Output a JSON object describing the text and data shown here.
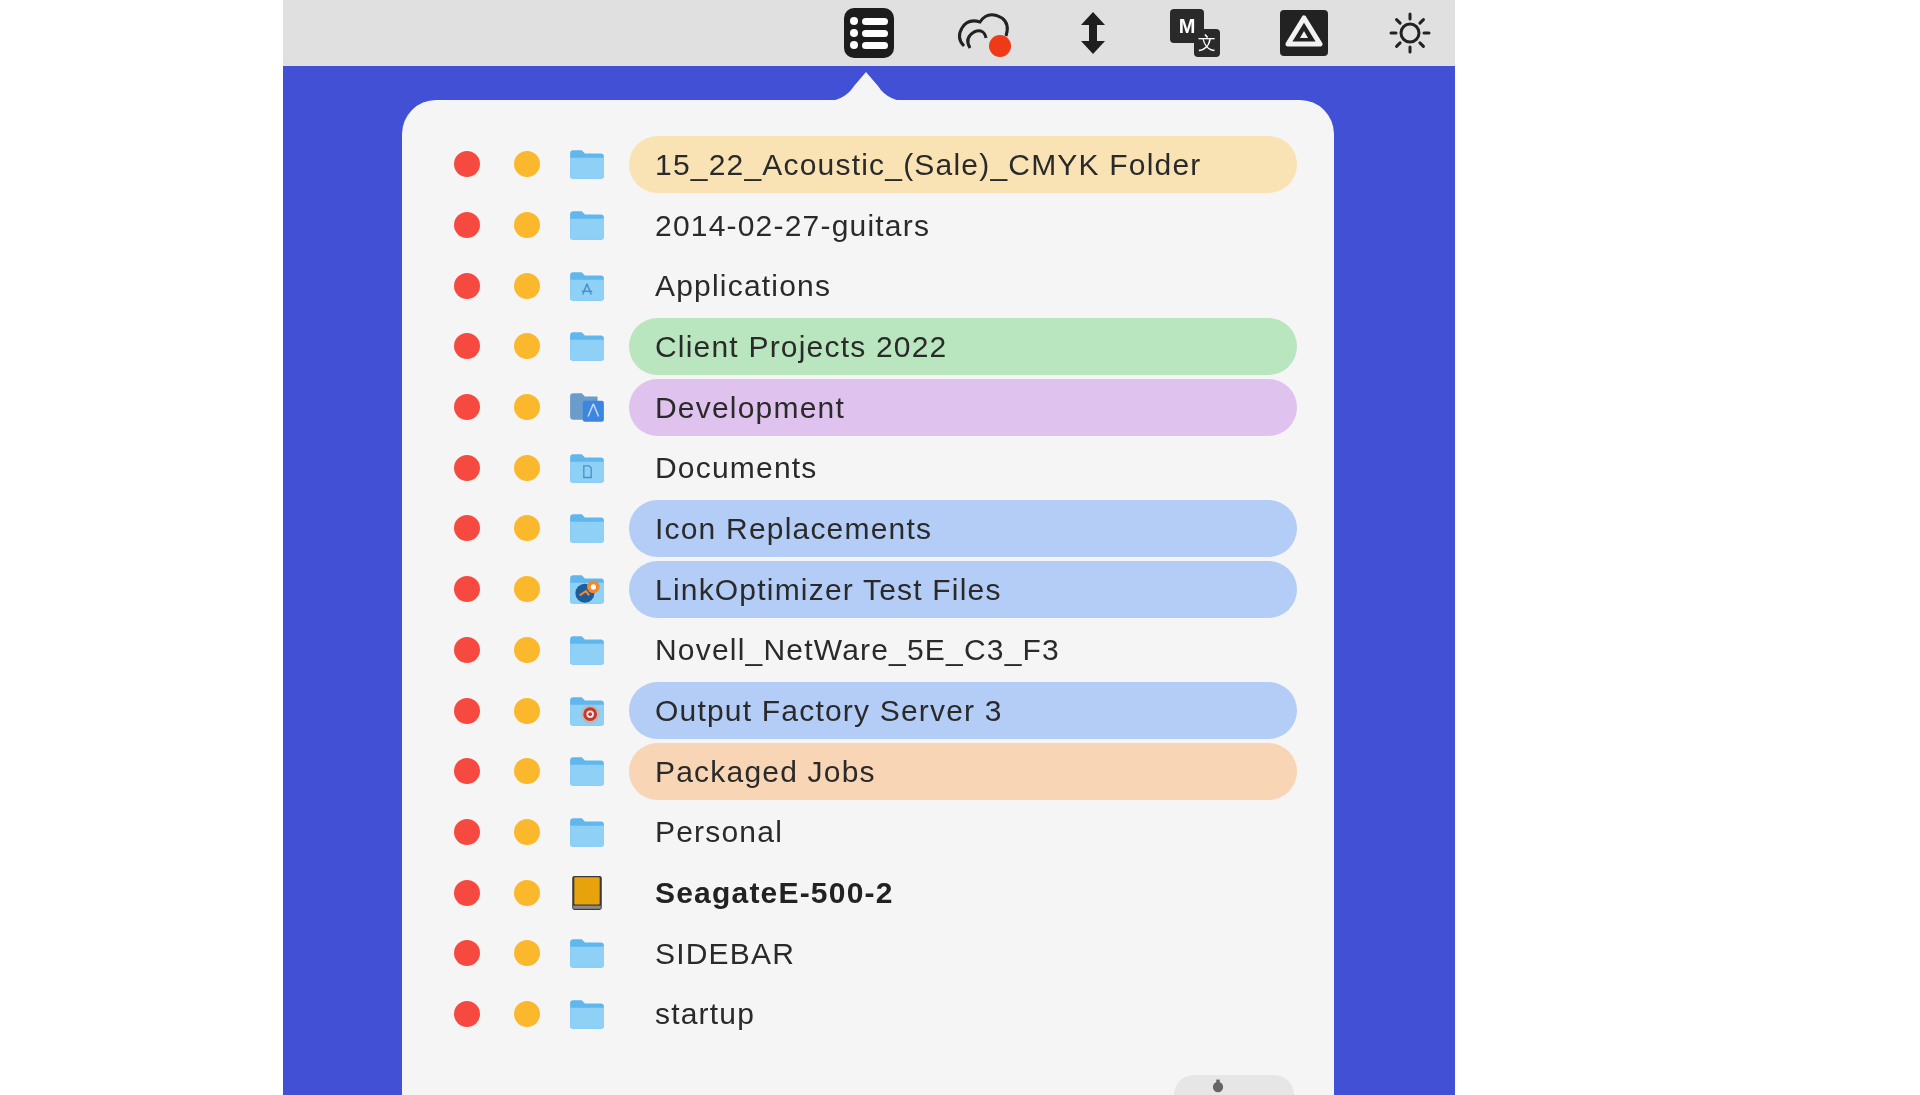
{
  "menu_bar": {
    "translate_letter": "M",
    "translate_glyph": "文"
  },
  "folders": [
    {
      "name": "15_22_Acoustic_(Sale)_CMYK Folder",
      "kind": "folder",
      "bold": false,
      "color": "#f9e3b4"
    },
    {
      "name": "2014-02-27-guitars",
      "kind": "folder",
      "bold": false
    },
    {
      "name": "Applications",
      "kind": "apps-folder",
      "bold": false
    },
    {
      "name": "Client Projects 2022",
      "kind": "folder",
      "bold": false,
      "color": "#b9e6bf"
    },
    {
      "name": "Development",
      "kind": "dev-folder",
      "bold": false,
      "color": "#dfc3ee"
    },
    {
      "name": "Documents",
      "kind": "docs-folder",
      "bold": false
    },
    {
      "name": "Icon Replacements",
      "kind": "folder",
      "bold": false,
      "color": "#b3cdf7"
    },
    {
      "name": "LinkOptimizer Test Files",
      "kind": "link-folder",
      "bold": false,
      "color": "#b3cdf7"
    },
    {
      "name": "Novell_NetWare_5E_C3_F3",
      "kind": "folder",
      "bold": false
    },
    {
      "name": "Output Factory Server 3",
      "kind": "output-folder",
      "bold": false,
      "color": "#b3cdf7"
    },
    {
      "name": "Packaged Jobs",
      "kind": "folder",
      "bold": false,
      "color": "#f8d5b4"
    },
    {
      "name": "Personal",
      "kind": "folder",
      "bold": false
    },
    {
      "name": "SeagateE-500-2",
      "kind": "drive",
      "bold": true
    },
    {
      "name": "SIDEBAR",
      "kind": "folder",
      "bold": false
    },
    {
      "name": "startup",
      "kind": "folder",
      "bold": false
    }
  ]
}
